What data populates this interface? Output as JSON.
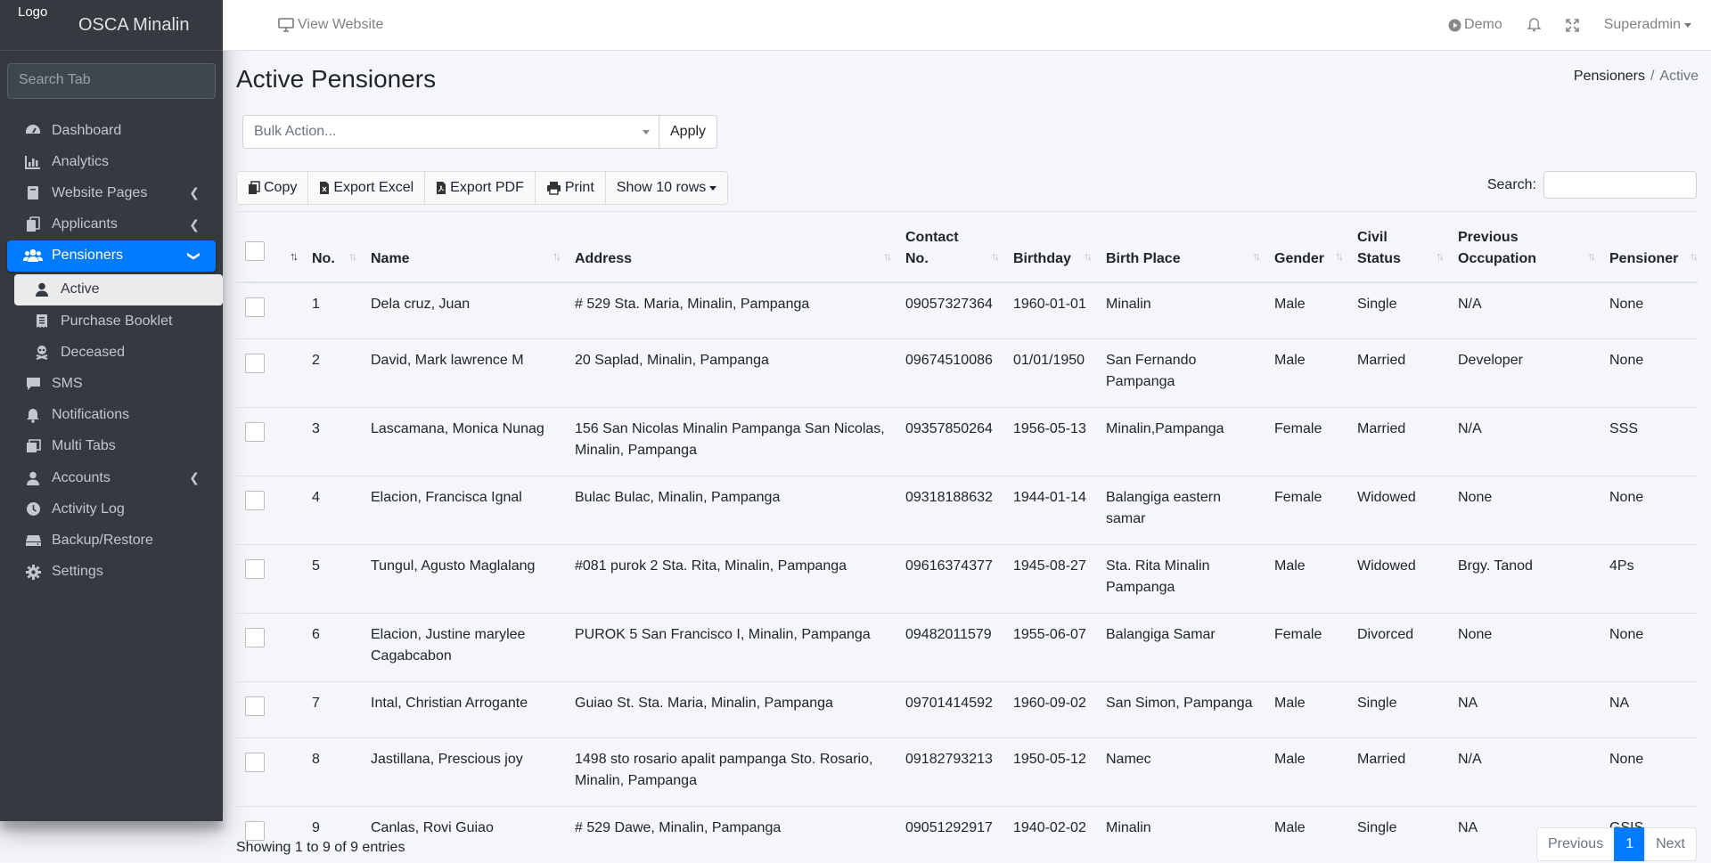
{
  "brand": {
    "logo_text": "Logo",
    "title": "OSCA Minalin"
  },
  "sidebar": {
    "search_placeholder": "Search Tab",
    "items": [
      {
        "label": "Dashboard",
        "icon": "dashboard-icon"
      },
      {
        "label": "Analytics",
        "icon": "chart-bar-icon"
      },
      {
        "label": "Website Pages",
        "icon": "book-icon"
      },
      {
        "label": "Applicants",
        "icon": "copy-icon"
      },
      {
        "label": "Pensioners",
        "icon": "users-icon"
      },
      {
        "label": "SMS",
        "icon": "message-icon"
      },
      {
        "label": "Notifications",
        "icon": "bell-icon"
      },
      {
        "label": "Multi Tabs",
        "icon": "tabs-icon"
      },
      {
        "label": "Accounts",
        "icon": "user-icon"
      },
      {
        "label": "Activity Log",
        "icon": "clock-icon"
      },
      {
        "label": "Backup/Restore",
        "icon": "hdd-icon"
      },
      {
        "label": "Settings",
        "icon": "gear-icon"
      }
    ],
    "sub_items": [
      {
        "label": "Active",
        "icon": "user-icon"
      },
      {
        "label": "Purchase Booklet",
        "icon": "receipt-icon"
      },
      {
        "label": "Deceased",
        "icon": "skull-icon"
      }
    ]
  },
  "topbar": {
    "view_website": "View Website",
    "demo": "Demo",
    "user": "Superadmin"
  },
  "page": {
    "title": "Active Pensioners",
    "breadcrumb": [
      "Pensioners",
      "Active"
    ]
  },
  "bulk": {
    "placeholder": "Bulk Action...",
    "apply": "Apply"
  },
  "buttons": {
    "copy": "Copy",
    "excel": "Export Excel",
    "pdf": "Export PDF",
    "print": "Print",
    "show_rows": "Show 10 rows"
  },
  "search_label": "Search:",
  "table": {
    "headers": [
      "No.",
      "Name",
      "Address",
      "Contact No.",
      "Birthday",
      "Birth Place",
      "Gender",
      "Civil Status",
      "Previous Occupation",
      "Pensioner"
    ],
    "rows": [
      [
        "1",
        "Dela cruz, Juan",
        "# 529 Sta. Maria, Minalin, Pampanga",
        "09057327364",
        "1960-01-01",
        "Minalin",
        "Male",
        "Single",
        "N/A",
        "None"
      ],
      [
        "2",
        "David, Mark lawrence M",
        "20 Saplad, Minalin, Pampanga",
        "09674510086",
        "01/01/1950",
        "San Fernando Pampanga",
        "Male",
        "Married",
        "Developer",
        "None"
      ],
      [
        "3",
        "Lascamana, Monica Nunag",
        "156 San Nicolas Minalin Pampanga San Nicolas, Minalin, Pampanga",
        "09357850264",
        "1956-05-13",
        "Minalin,Pampanga",
        "Female",
        "Married",
        "N/A",
        "SSS"
      ],
      [
        "4",
        "Elacion, Francisca Ignal",
        "Bulac Bulac, Minalin, Pampanga",
        "09318188632",
        "1944-01-14",
        "Balangiga eastern samar",
        "Female",
        "Widowed",
        "None",
        "None"
      ],
      [
        "5",
        "Tungul, Agusto Maglalang",
        "#081 purok 2 Sta. Rita, Minalin, Pampanga",
        "09616374377",
        "1945-08-27",
        "Sta. Rita Minalin Pampanga",
        "Male",
        "Widowed",
        "Brgy. Tanod",
        "4Ps"
      ],
      [
        "6",
        "Elacion, Justine marylee Cagabcabon",
        "PUROK 5 San Francisco I, Minalin, Pampanga",
        "09482011579",
        "1955-06-07",
        "Balangiga Samar",
        "Female",
        "Divorced",
        "None",
        "None"
      ],
      [
        "7",
        "Intal, Christian Arrogante",
        "Guiao St. Sta. Maria, Minalin, Pampanga",
        "09701414592",
        "1960-09-02",
        "San Simon, Pampanga",
        "Male",
        "Single",
        "NA",
        "NA"
      ],
      [
        "8",
        "Jastillana, Prescious joy",
        "1498 sto rosario apalit pampanga Sto. Rosario, Minalin, Pampanga",
        "09182793213",
        "1950-05-12",
        "Namec",
        "Male",
        "Married",
        "N/A",
        "None"
      ],
      [
        "9",
        "Canlas, Rovi Guiao",
        "# 529 Dawe, Minalin, Pampanga",
        "09051292917",
        "1940-02-02",
        "Minalin",
        "Male",
        "Single",
        "NA",
        "GSIS"
      ]
    ]
  },
  "info": "Showing 1 to 9 of 9 entries",
  "pager": {
    "prev": "Previous",
    "page": "1",
    "next": "Next"
  },
  "colors": {
    "sidebar": "#343a40",
    "accent": "#007bff",
    "content_bg": "#f4f6f9"
  }
}
